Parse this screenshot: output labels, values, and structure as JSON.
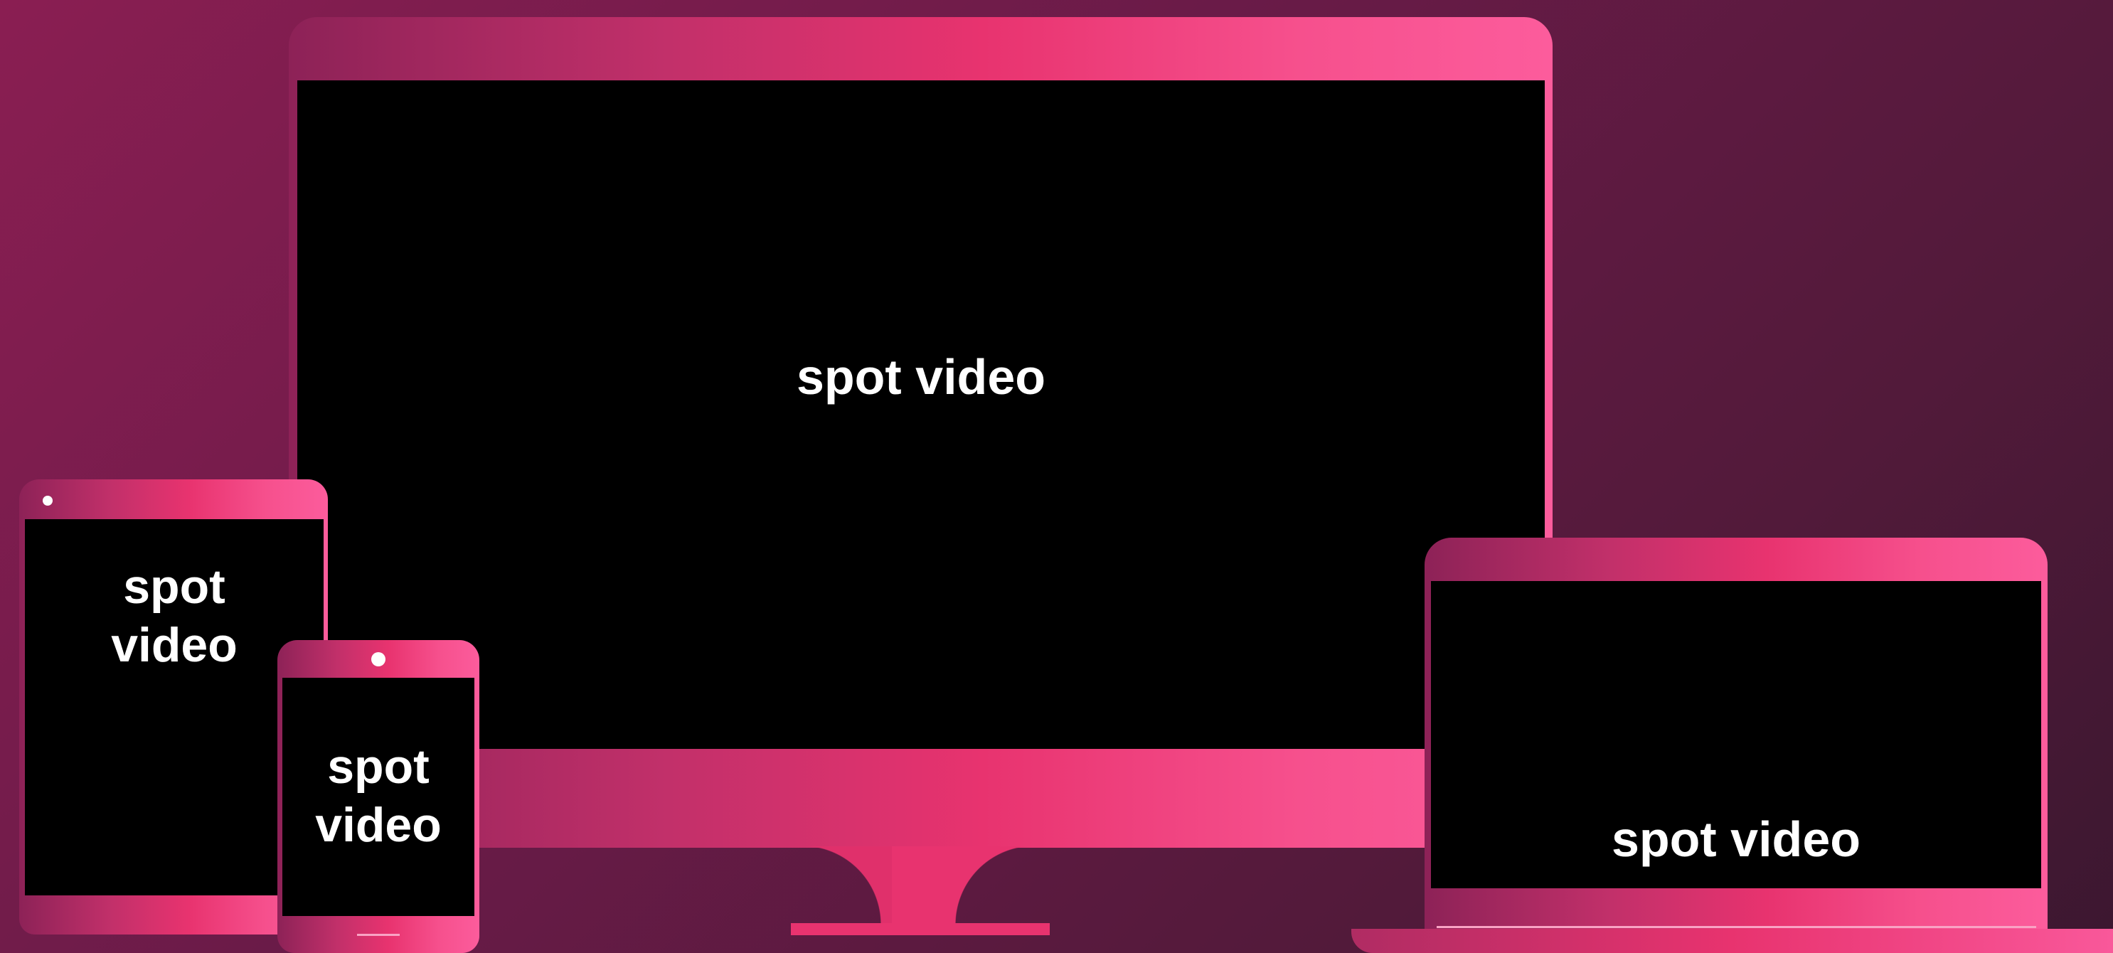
{
  "devices": {
    "monitor": {
      "label": "spot video"
    },
    "laptop": {
      "label": "spot video"
    },
    "tablet": {
      "label": "spot\nvideo"
    },
    "phone": {
      "label": "spot\nvideo"
    }
  },
  "colors": {
    "background": "#6a1b48",
    "frame_start": "#8d2257",
    "frame_mid": "#e8336f",
    "frame_end": "#fc5c9c",
    "screen": "#000000",
    "text": "#ffffff"
  },
  "icons": {
    "tablet_camera": "camera-dot-icon",
    "phone_camera": "camera-dot-icon"
  }
}
